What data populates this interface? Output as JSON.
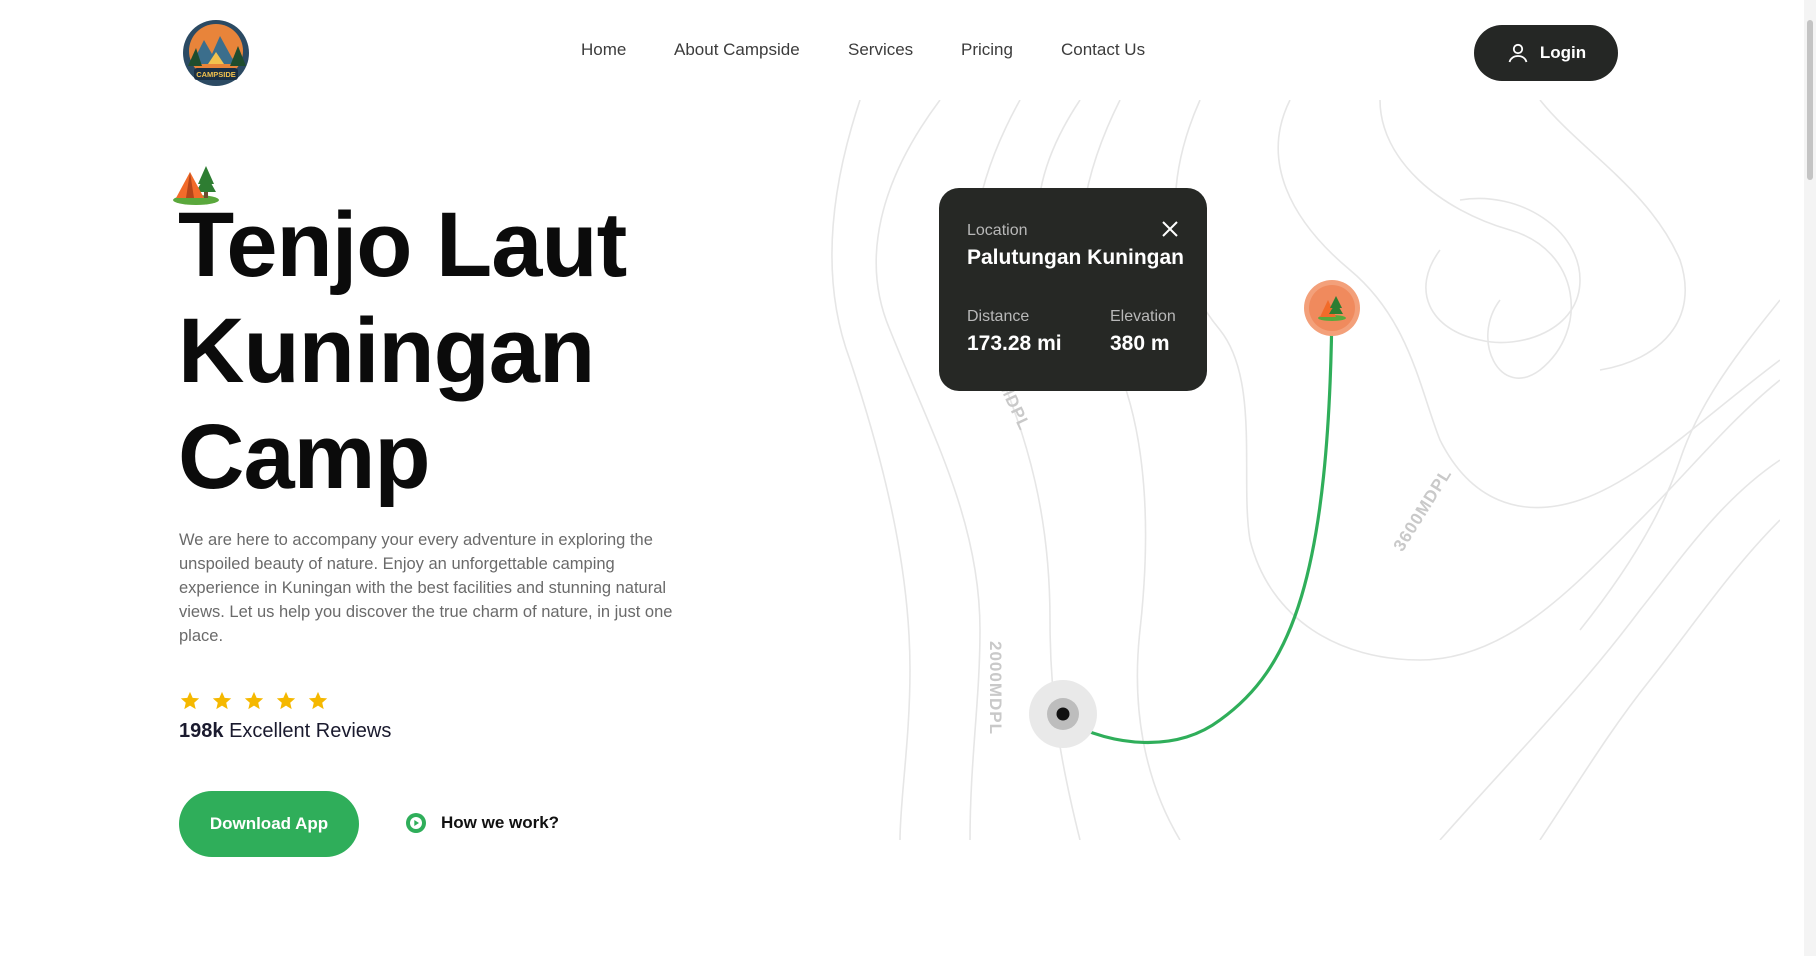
{
  "brand": {
    "logo_text": "CAMPSIDE"
  },
  "nav": {
    "items": [
      {
        "label": "Home"
      },
      {
        "label": "About Campside"
      },
      {
        "label": "Services"
      },
      {
        "label": "Pricing"
      },
      {
        "label": "Contact Us"
      }
    ],
    "login_label": "Login"
  },
  "hero": {
    "title_lines": [
      "Tenjo Laut",
      "Kuningan",
      "Camp"
    ],
    "description": "We are here to accompany your every adventure in exploring the unspoiled beauty of nature. Enjoy an unforgettable camping experience in Kuningan with the best facilities and stunning natural views. Let us help you discover the true charm of nature, in just one place.",
    "rating": {
      "stars": 5,
      "count": "198k",
      "label": "Excellent Reviews"
    },
    "download_label": "Download App",
    "how_label": "How we work?"
  },
  "map": {
    "card": {
      "location_label": "Location",
      "location_value": "Palutungan Kuningan",
      "distance_label": "Distance",
      "distance_value": "173.28 mi",
      "elevation_label": "Elevation",
      "elevation_value": "380 m"
    },
    "contour_labels": [
      "MDPL",
      "3600MDPL",
      "2000MDPL"
    ]
  },
  "colors": {
    "accent_green": "#2fae5a",
    "dark": "#252725",
    "pin_orange": "#f08a5d",
    "star": "#f5b800"
  }
}
